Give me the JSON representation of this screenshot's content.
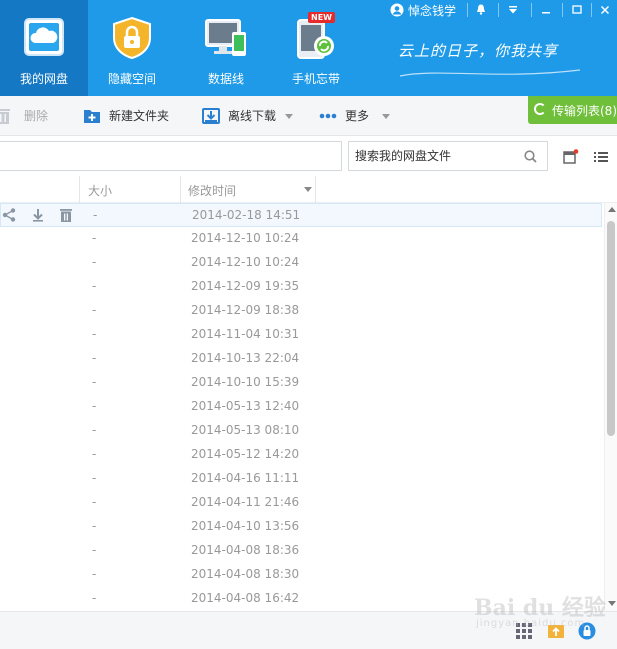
{
  "nav": {
    "tabs": [
      {
        "label": "我的网盘",
        "icon": "cloud-drive-icon",
        "active": true
      },
      {
        "label": "隐藏空间",
        "icon": "lock-shield-icon",
        "active": false
      },
      {
        "label": "数据线",
        "icon": "device-sync-icon",
        "active": false
      },
      {
        "label": "手机忘带",
        "icon": "phone-sync-icon",
        "active": false,
        "badge": "NEW"
      }
    ],
    "slogan": "云上的日子，你我共享"
  },
  "window": {
    "username": "悼念钱学"
  },
  "toolbar": {
    "delete_label": "删除",
    "new_folder_label": "新建文件夹",
    "offline_download_label": "离线下载",
    "more_label": "更多",
    "transfer_label": "传输列表(8)"
  },
  "search": {
    "placeholder": "搜索我的网盘文件"
  },
  "columns": {
    "size": "大小",
    "modified": "修改时间"
  },
  "files": [
    {
      "size": "-",
      "modified": "2014-02-18 14:51"
    },
    {
      "size": "-",
      "modified": "2014-12-10 10:24"
    },
    {
      "size": "-",
      "modified": "2014-12-10 10:24"
    },
    {
      "size": "-",
      "modified": "2014-12-09 19:35"
    },
    {
      "size": "-",
      "modified": "2014-12-09 18:38"
    },
    {
      "size": "-",
      "modified": "2014-11-04 10:31"
    },
    {
      "size": "-",
      "modified": "2014-10-13 22:04"
    },
    {
      "size": "-",
      "modified": "2014-10-10 15:39"
    },
    {
      "size": "-",
      "modified": "2014-05-13 12:40"
    },
    {
      "size": "-",
      "modified": "2014-05-13 08:10"
    },
    {
      "size": "-",
      "modified": "2014-05-12 14:20"
    },
    {
      "size": "-",
      "modified": "2014-04-16 11:11"
    },
    {
      "size": "-",
      "modified": "2014-04-11 21:46"
    },
    {
      "size": "-",
      "modified": "2014-04-10 13:56"
    },
    {
      "size": "-",
      "modified": "2014-04-08 18:36"
    },
    {
      "size": "-",
      "modified": "2014-04-08 18:30"
    },
    {
      "size": "-",
      "modified": "2014-04-08 16:42"
    }
  ],
  "watermark": {
    "main": "Bai du 经验",
    "sub": "jingyan.baidu.com"
  },
  "colors": {
    "header_blue": "#1e9ae8",
    "active_tab": "#1478c4",
    "transfer_green": "#6fbf3a"
  }
}
